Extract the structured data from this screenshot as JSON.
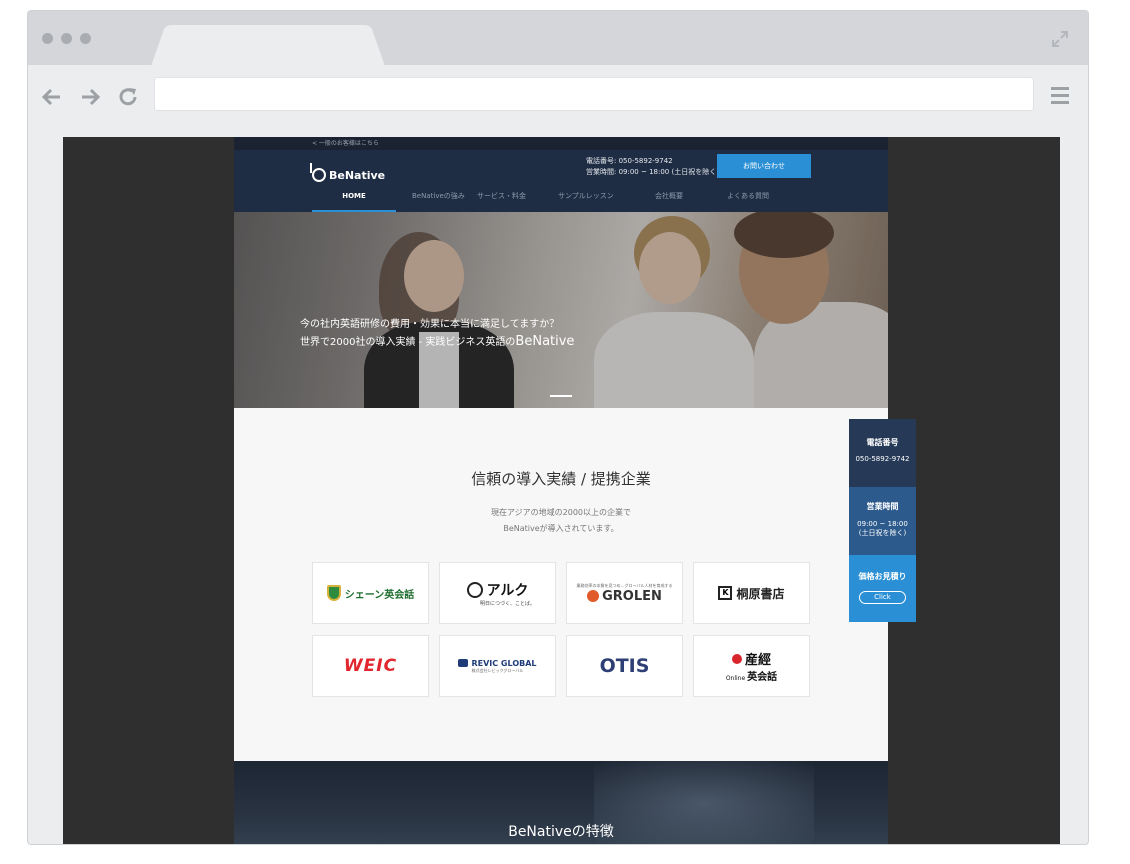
{
  "site": {
    "top_link": "<  一般のお客様はこちら",
    "logo_text": "BeNative",
    "phone_line": "電話番号: 050-5892-9742",
    "hours_line": "営業時間: 09:00 ~ 18:00 (土日祝を除く)",
    "inquiry_button": "お問い合わせ",
    "nav": [
      "HOME",
      "BeNativeの強み",
      "サービス・料金",
      "サンプルレッスン",
      "会社概要",
      "よくある質問"
    ],
    "hero": {
      "line1": "今の社内英語研修の費用・効果に本当に満足してますか？",
      "line2_prefix": "世界で2000社の導入実績 - 実践ビジネス英語の",
      "line2_brand": "BeNative"
    },
    "partners": {
      "title": "信頼の導入実績 / 提携企業",
      "desc_line1": "現在アジアの地域の2000以上の企業で",
      "desc_line2": "BeNativeが導入されています。",
      "logos": [
        "シェーン英会話",
        "アルク",
        "GROLEN",
        "桐原書店",
        "WEIC",
        "REVIC GLOBAL",
        "OTIS",
        "産經 Online 英会話"
      ],
      "alk_tagline": "明日につづく、ことば。",
      "grolen_tagline": "業務効率の本質を見つめ…グローバル人材を育成する",
      "revic_sub": "株式会社レビックグローバル",
      "sankei_sub": "Online",
      "sankei_sub2": "英会話"
    },
    "side": {
      "phone_label": "電話番号",
      "phone_value": "050-5892-9742",
      "hours_label": "営業時間",
      "hours_value1": "09:00 ~ 18:00",
      "hours_value2": "(土日祝を除く)",
      "quote_label": "価格お見積り",
      "quote_button": "Click"
    },
    "features_title": "BeNativeの特徴"
  },
  "colors": {
    "header_bg": "#1f2d44",
    "accent_blue": "#2a8fd4",
    "side_dark": "#263a58",
    "side_mid": "#2d5a8c",
    "side_light": "#2a8fd4"
  }
}
